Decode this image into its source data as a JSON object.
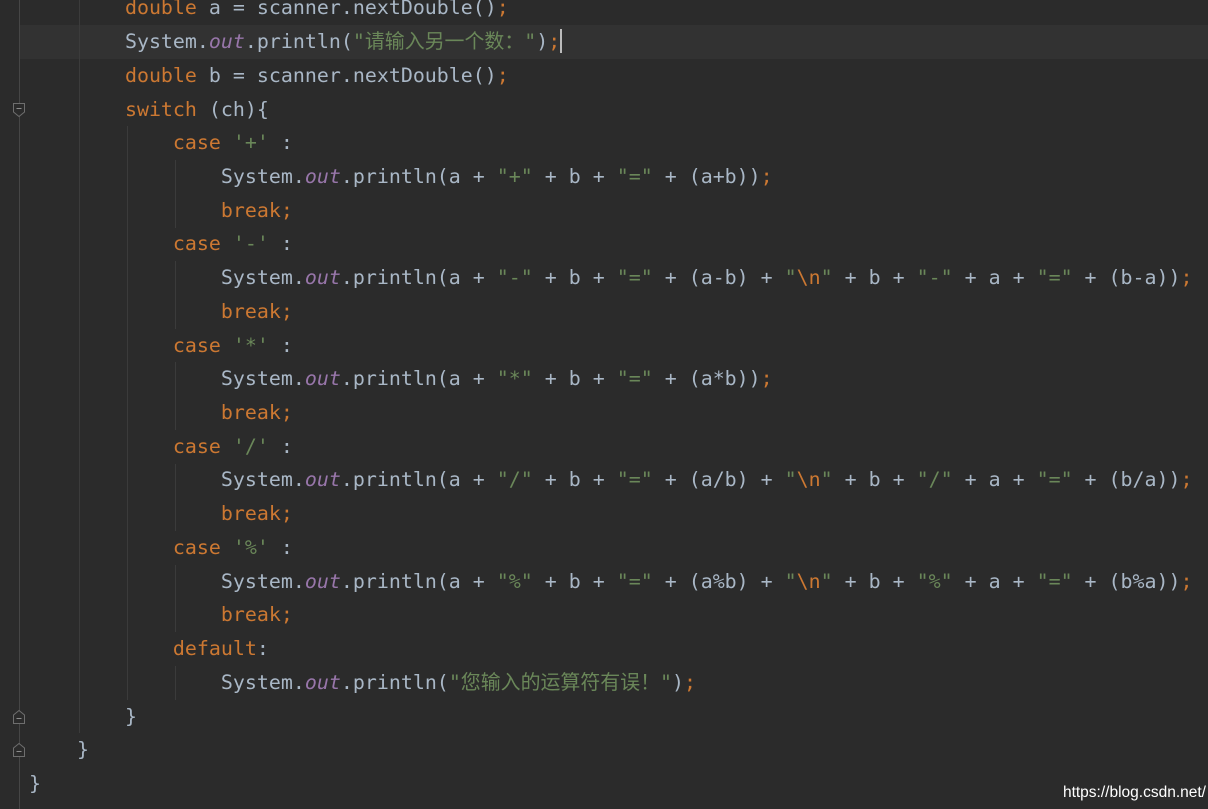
{
  "editor": {
    "theme": {
      "background": "#2B2B2B",
      "current_line_background": "#323232",
      "caret": "#BBBBBB"
    },
    "lines": [
      {
        "tokens": [
          [
            "        double",
            "#CC7832"
          ],
          [
            " a = scanner.nextDouble()",
            "#A9B7C6"
          ],
          [
            ";",
            "#CC7832"
          ]
        ]
      },
      {
        "current": true,
        "caret": true,
        "tokens": [
          [
            "        System.",
            "#A9B7C6"
          ],
          [
            "out",
            "#9876AA",
            true
          ],
          [
            ".println(",
            "#A9B7C6"
          ],
          [
            "\"请输入另一个数：\"",
            "#6A8759"
          ],
          [
            ")",
            "#A9B7C6"
          ],
          [
            ";",
            "#CC7832"
          ]
        ]
      },
      {
        "tokens": [
          [
            "        double",
            "#CC7832"
          ],
          [
            " b = scanner.nextDouble()",
            "#A9B7C6"
          ],
          [
            ";",
            "#CC7832"
          ]
        ]
      },
      {
        "fold": "fold-collapse-icon",
        "tokens": [
          [
            "        switch",
            "#CC7832"
          ],
          [
            " (ch){",
            "#A9B7C6"
          ]
        ]
      },
      {
        "tokens": [
          [
            "            case ",
            "#CC7832"
          ],
          [
            "'+'",
            "#6A8759"
          ],
          [
            " :",
            "#A9B7C6"
          ]
        ]
      },
      {
        "tokens": [
          [
            "                System.",
            "#A9B7C6"
          ],
          [
            "out",
            "#9876AA",
            true
          ],
          [
            ".println(a + ",
            "#A9B7C6"
          ],
          [
            "\"+\"",
            "#6A8759"
          ],
          [
            " + b + ",
            "#A9B7C6"
          ],
          [
            "\"=\"",
            "#6A8759"
          ],
          [
            " + (a+b))",
            "#A9B7C6"
          ],
          [
            ";",
            "#CC7832"
          ]
        ]
      },
      {
        "tokens": [
          [
            "                break;",
            "#CC7832"
          ]
        ]
      },
      {
        "tokens": [
          [
            "            case ",
            "#CC7832"
          ],
          [
            "'-'",
            "#6A8759"
          ],
          [
            " :",
            "#A9B7C6"
          ]
        ]
      },
      {
        "tokens": [
          [
            "                System.",
            "#A9B7C6"
          ],
          [
            "out",
            "#9876AA",
            true
          ],
          [
            ".println(a + ",
            "#A9B7C6"
          ],
          [
            "\"-\"",
            "#6A8759"
          ],
          [
            " + b + ",
            "#A9B7C6"
          ],
          [
            "\"=\"",
            "#6A8759"
          ],
          [
            " + (a-b) + ",
            "#A9B7C6"
          ],
          [
            "\"",
            "#6A8759"
          ],
          [
            "\\n",
            "#CC7832"
          ],
          [
            "\"",
            "#6A8759"
          ],
          [
            " + b + ",
            "#A9B7C6"
          ],
          [
            "\"-\"",
            "#6A8759"
          ],
          [
            " + a + ",
            "#A9B7C6"
          ],
          [
            "\"=\"",
            "#6A8759"
          ],
          [
            " + (b-a))",
            "#A9B7C6"
          ],
          [
            ";",
            "#CC7832"
          ]
        ]
      },
      {
        "tokens": [
          [
            "                break;",
            "#CC7832"
          ]
        ]
      },
      {
        "tokens": [
          [
            "            case ",
            "#CC7832"
          ],
          [
            "'*'",
            "#6A8759"
          ],
          [
            " :",
            "#A9B7C6"
          ]
        ]
      },
      {
        "tokens": [
          [
            "                System.",
            "#A9B7C6"
          ],
          [
            "out",
            "#9876AA",
            true
          ],
          [
            ".println(a + ",
            "#A9B7C6"
          ],
          [
            "\"*\"",
            "#6A8759"
          ],
          [
            " + b + ",
            "#A9B7C6"
          ],
          [
            "\"=\"",
            "#6A8759"
          ],
          [
            " + (a*b))",
            "#A9B7C6"
          ],
          [
            ";",
            "#CC7832"
          ]
        ]
      },
      {
        "tokens": [
          [
            "                break;",
            "#CC7832"
          ]
        ]
      },
      {
        "tokens": [
          [
            "            case ",
            "#CC7832"
          ],
          [
            "'/'",
            "#6A8759"
          ],
          [
            " :",
            "#A9B7C6"
          ]
        ]
      },
      {
        "tokens": [
          [
            "                System.",
            "#A9B7C6"
          ],
          [
            "out",
            "#9876AA",
            true
          ],
          [
            ".println(a + ",
            "#A9B7C6"
          ],
          [
            "\"/\"",
            "#6A8759"
          ],
          [
            " + b + ",
            "#A9B7C6"
          ],
          [
            "\"=\"",
            "#6A8759"
          ],
          [
            " + (a/b) + ",
            "#A9B7C6"
          ],
          [
            "\"",
            "#6A8759"
          ],
          [
            "\\n",
            "#CC7832"
          ],
          [
            "\"",
            "#6A8759"
          ],
          [
            " + b + ",
            "#A9B7C6"
          ],
          [
            "\"/\"",
            "#6A8759"
          ],
          [
            " + a + ",
            "#A9B7C6"
          ],
          [
            "\"=\"",
            "#6A8759"
          ],
          [
            " + (b/a))",
            "#A9B7C6"
          ],
          [
            ";",
            "#CC7832"
          ]
        ]
      },
      {
        "tokens": [
          [
            "                break;",
            "#CC7832"
          ]
        ]
      },
      {
        "tokens": [
          [
            "            case ",
            "#CC7832"
          ],
          [
            "'%'",
            "#6A8759"
          ],
          [
            " :",
            "#A9B7C6"
          ]
        ]
      },
      {
        "tokens": [
          [
            "                System.",
            "#A9B7C6"
          ],
          [
            "out",
            "#9876AA",
            true
          ],
          [
            ".println(a + ",
            "#A9B7C6"
          ],
          [
            "\"%\"",
            "#6A8759"
          ],
          [
            " + b + ",
            "#A9B7C6"
          ],
          [
            "\"=\"",
            "#6A8759"
          ],
          [
            " + (a%b) + ",
            "#A9B7C6"
          ],
          [
            "\"",
            "#6A8759"
          ],
          [
            "\\n",
            "#CC7832"
          ],
          [
            "\"",
            "#6A8759"
          ],
          [
            " + b + ",
            "#A9B7C6"
          ],
          [
            "\"%\"",
            "#6A8759"
          ],
          [
            " + a + ",
            "#A9B7C6"
          ],
          [
            "\"=\"",
            "#6A8759"
          ],
          [
            " + (b%a))",
            "#A9B7C6"
          ],
          [
            ";",
            "#CC7832"
          ]
        ]
      },
      {
        "tokens": [
          [
            "                break;",
            "#CC7832"
          ]
        ]
      },
      {
        "tokens": [
          [
            "            default",
            "#CC7832"
          ],
          [
            ":",
            "#A9B7C6"
          ]
        ]
      },
      {
        "tokens": [
          [
            "                System.",
            "#A9B7C6"
          ],
          [
            "out",
            "#9876AA",
            true
          ],
          [
            ".println(",
            "#A9B7C6"
          ],
          [
            "\"您输入的运算符有误！\"",
            "#6A8759"
          ],
          [
            ")",
            "#A9B7C6"
          ],
          [
            ";",
            "#CC7832"
          ]
        ]
      },
      {
        "fold": "fold-end-icon",
        "tokens": [
          [
            "        }",
            "#A9B7C6"
          ]
        ]
      },
      {
        "fold": "fold-end-icon",
        "tokens": [
          [
            "    }",
            "#A9B7C6"
          ]
        ]
      },
      {
        "tokens": [
          [
            "}",
            "#A9B7C6"
          ]
        ]
      }
    ]
  },
  "watermark": "https://blog.csdn.net/"
}
